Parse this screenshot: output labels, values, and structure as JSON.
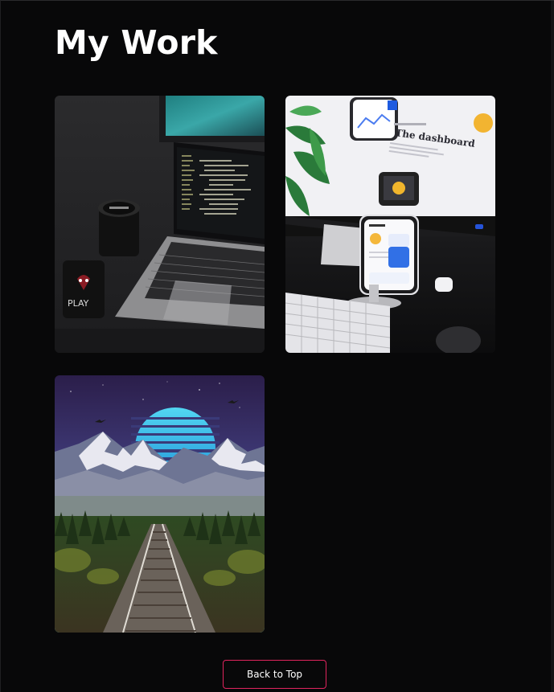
{
  "section": {
    "title": "My Work"
  },
  "gallery": {
    "items": [
      {
        "icon": "laptop-code-photo",
        "phone_case_text": "PLAY"
      },
      {
        "icon": "dashboard-mockup-photo",
        "screen_title": "The dashboard"
      },
      {
        "icon": "mountain-railway-photo"
      }
    ]
  },
  "footer": {
    "back_to_top_label": "Back to Top"
  },
  "colors": {
    "background": "#080809",
    "title": "#ffffff",
    "button_border": "#e0245e",
    "button_text": "#ffffff"
  }
}
